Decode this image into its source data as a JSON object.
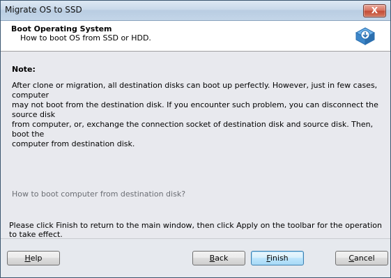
{
  "window": {
    "title": "Migrate OS to SSD",
    "close_label": "X"
  },
  "header": {
    "title": "Boot Operating System",
    "subtitle": "How to boot OS from SSD or HDD."
  },
  "content": {
    "note_label": "Note:",
    "note_line_1": "After clone or migration, all destination disks can boot up perfectly. However, just in few cases, computer",
    "note_line_2": "may not boot from the destination disk. If you encounter such problem, you can disconnect the source disk",
    "note_line_3": "from computer, or, exchange the connection socket of destination disk and source disk. Then, boot the",
    "note_line_4": "computer from destination disk.",
    "howto_link": "How to boot computer from destination disk?",
    "instruction": "Please click Finish to return to the main window, then click Apply on the toolbar for the operation to take effect."
  },
  "buttons": {
    "help": {
      "mnemonic": "H",
      "rest": "elp"
    },
    "back": {
      "mnemonic": "B",
      "rest": "ack"
    },
    "finish": {
      "mnemonic": "F",
      "rest": "inish"
    },
    "cancel": {
      "mnemonic": "C",
      "rest": "ancel"
    }
  },
  "icons": {
    "header_icon": "disk-download-icon"
  }
}
